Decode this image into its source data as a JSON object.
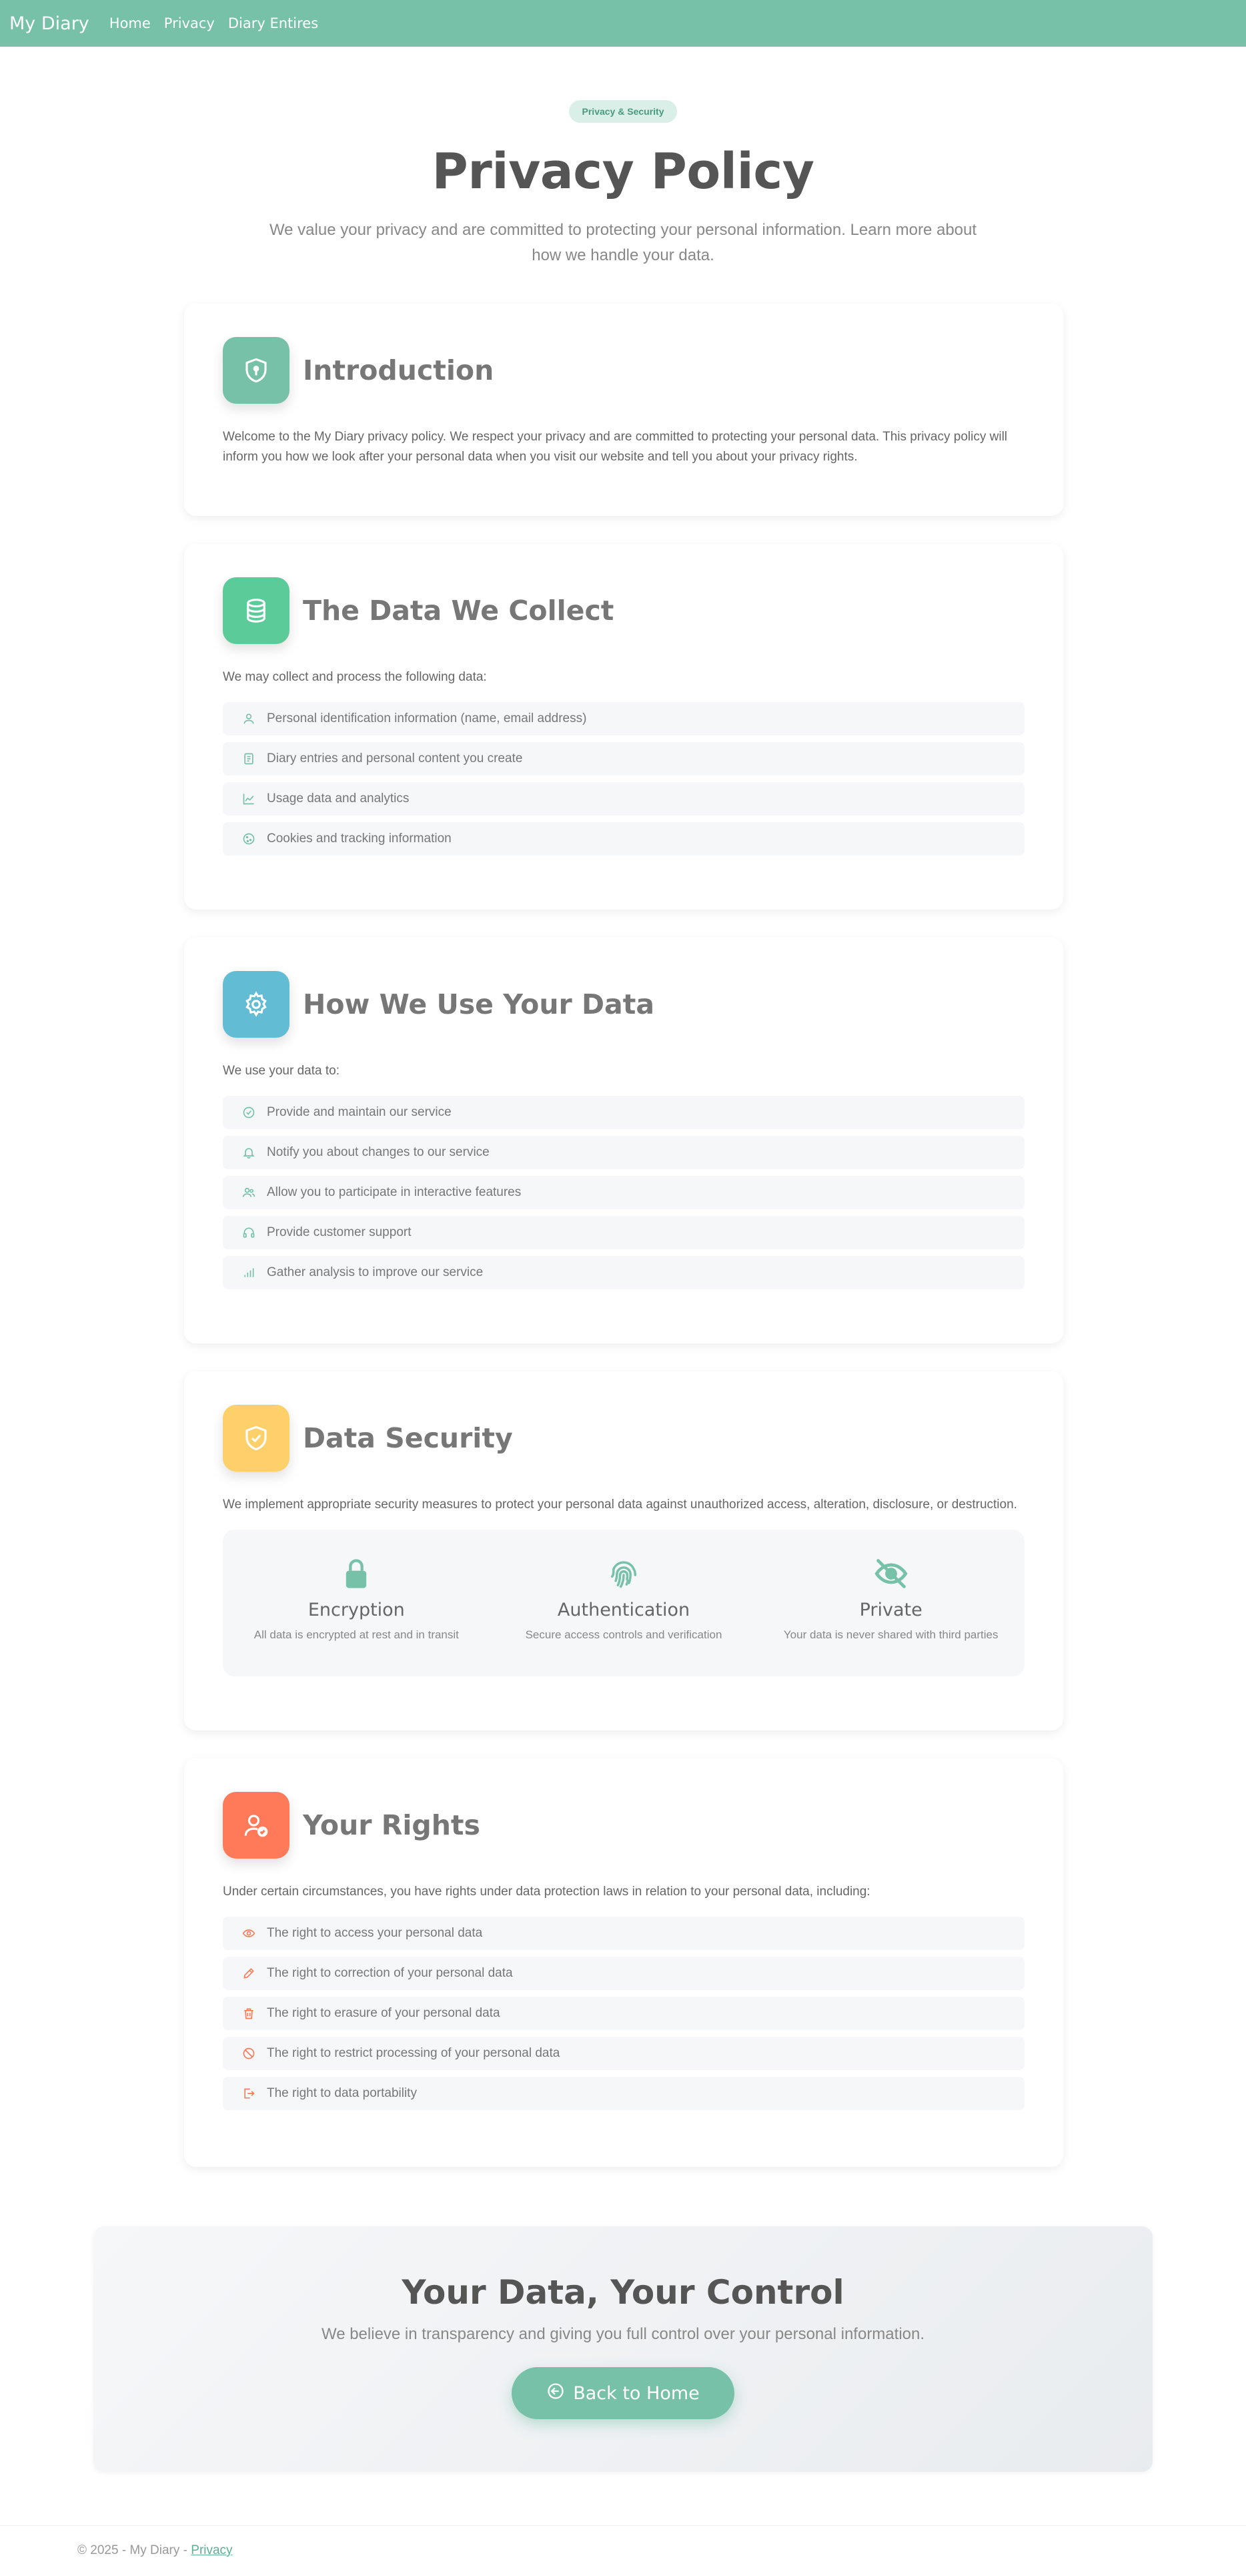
{
  "nav": {
    "brand": "My Diary",
    "links": [
      "Home",
      "Privacy",
      "Diary Entires"
    ]
  },
  "hero": {
    "badge": "Privacy & Security",
    "title": "Privacy Policy",
    "subtitle": "We value your privacy and are committed to protecting your personal information. Learn more about how we handle your data."
  },
  "sections": {
    "introduction": {
      "title": "Introduction",
      "icon": "shield-icon",
      "color": "#76c1a8",
      "text": "Welcome to the My Diary privacy policy. We respect your privacy and are committed to protecting your personal data. This privacy policy will inform you how we look after your personal data when you visit our website and tell you about your privacy rights."
    },
    "collect": {
      "title": "The Data We Collect",
      "icon": "database-icon",
      "color": "#5ccb9a",
      "text": "We may collect and process the following data:",
      "items": [
        {
          "label": "Personal identification information (name, email address)",
          "icon": "user-icon"
        },
        {
          "label": "Diary entries and personal content you create",
          "icon": "document-icon"
        },
        {
          "label": "Usage data and analytics",
          "icon": "chart-icon"
        },
        {
          "label": "Cookies and tracking information",
          "icon": "cookie-icon"
        }
      ]
    },
    "use": {
      "title": "How We Use Your Data",
      "icon": "gear-icon",
      "color": "#62bcd4",
      "text": "We use your data to:",
      "items": [
        {
          "label": "Provide and maintain our service",
          "icon": "check-circle-icon"
        },
        {
          "label": "Notify you about changes to our service",
          "icon": "bell-icon"
        },
        {
          "label": "Allow you to participate in interactive features",
          "icon": "users-icon"
        },
        {
          "label": "Provide customer support",
          "icon": "headset-icon"
        },
        {
          "label": "Gather analysis to improve our service",
          "icon": "bar-chart-icon"
        }
      ]
    },
    "security": {
      "title": "Data Security",
      "icon": "shield-check-icon",
      "color": "#fdd06a",
      "text": "We implement appropriate security measures to protect your personal data against unauthorized access, alteration, disclosure, or destruction.",
      "features": [
        {
          "title": "Encryption",
          "desc": "All data is encrypted at rest and in transit",
          "icon": "lock-icon"
        },
        {
          "title": "Authentication",
          "desc": "Secure access controls and verification",
          "icon": "fingerprint-icon"
        },
        {
          "title": "Private",
          "desc": "Your data is never shared with third parties",
          "icon": "eye-slash-icon"
        }
      ]
    },
    "rights": {
      "title": "Your Rights",
      "icon": "user-check-icon",
      "color": "#ff7a59",
      "text": "Under certain circumstances, you have rights under data protection laws in relation to your personal data, including:",
      "items": [
        {
          "label": "The right to access your personal data",
          "icon": "eye-icon"
        },
        {
          "label": "The right to correction of your personal data",
          "icon": "pencil-icon"
        },
        {
          "label": "The right to erasure of your personal data",
          "icon": "trash-icon"
        },
        {
          "label": "The right to restrict processing of your personal data",
          "icon": "ban-icon"
        },
        {
          "label": "The right to data portability",
          "icon": "export-icon"
        }
      ]
    }
  },
  "cta": {
    "title": "Your Data, Your Control",
    "subtitle": "We believe in transparency and giving you full control over your personal information.",
    "button": "Back to Home"
  },
  "footer": {
    "text": "© 2025 - My Diary - ",
    "link": "Privacy"
  },
  "colors": {
    "primary": "#76c1a8",
    "rights_accent": "#ff7a59"
  }
}
